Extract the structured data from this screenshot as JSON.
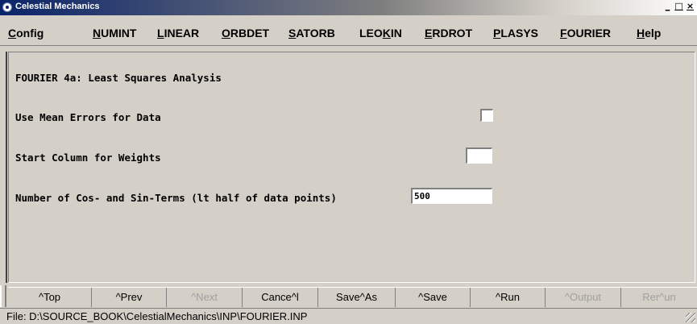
{
  "window": {
    "title": "Celestial Mechanics",
    "controls": {
      "minimize": "_",
      "maximize": "□",
      "close": "×"
    }
  },
  "menu": [
    {
      "label": "Config",
      "hotkey_index": 0
    },
    {
      "label": "NUMINT",
      "hotkey_index": 0
    },
    {
      "label": "LINEAR",
      "hotkey_index": 0
    },
    {
      "label": "ORBDET",
      "hotkey_index": 0
    },
    {
      "label": "SATORB",
      "hotkey_index": 0
    },
    {
      "label": "LEOKIN",
      "hotkey_index": 3
    },
    {
      "label": "ERDROT",
      "hotkey_index": 0
    },
    {
      "label": "PLASYS",
      "hotkey_index": 0
    },
    {
      "label": "FOURIER",
      "hotkey_index": 0
    },
    {
      "label": "Help",
      "hotkey_index": 0
    }
  ],
  "form": {
    "heading": "FOURIER 4a: Least Squares Analysis",
    "use_mean_errors_label": "Use Mean Errors for Data",
    "use_mean_errors_checked": false,
    "start_column_label": "Start Column for Weights",
    "start_column_value": "",
    "num_terms_label": "Number of Cos- and Sin-Terms (lt half of data points)",
    "num_terms_value": "500"
  },
  "buttons": [
    {
      "label": "^Top",
      "enabled": true
    },
    {
      "label": "^Prev",
      "enabled": true
    },
    {
      "label": "^Next",
      "enabled": false
    },
    {
      "label": "Cance^l",
      "enabled": true
    },
    {
      "label": "Save^As",
      "enabled": true
    },
    {
      "label": "^Save",
      "enabled": true
    },
    {
      "label": "^Run",
      "enabled": true
    },
    {
      "label": "^Output",
      "enabled": false
    },
    {
      "label": "Rer^un",
      "enabled": false
    }
  ],
  "status": {
    "file_path": "File: D:\\SOURCE_BOOK\\CelestialMechanics\\INP\\FOURIER.INP"
  },
  "colors": {
    "title_active": "#0a246a",
    "face": "#d4d0c8",
    "disabled_text": "#a0a0a0"
  }
}
